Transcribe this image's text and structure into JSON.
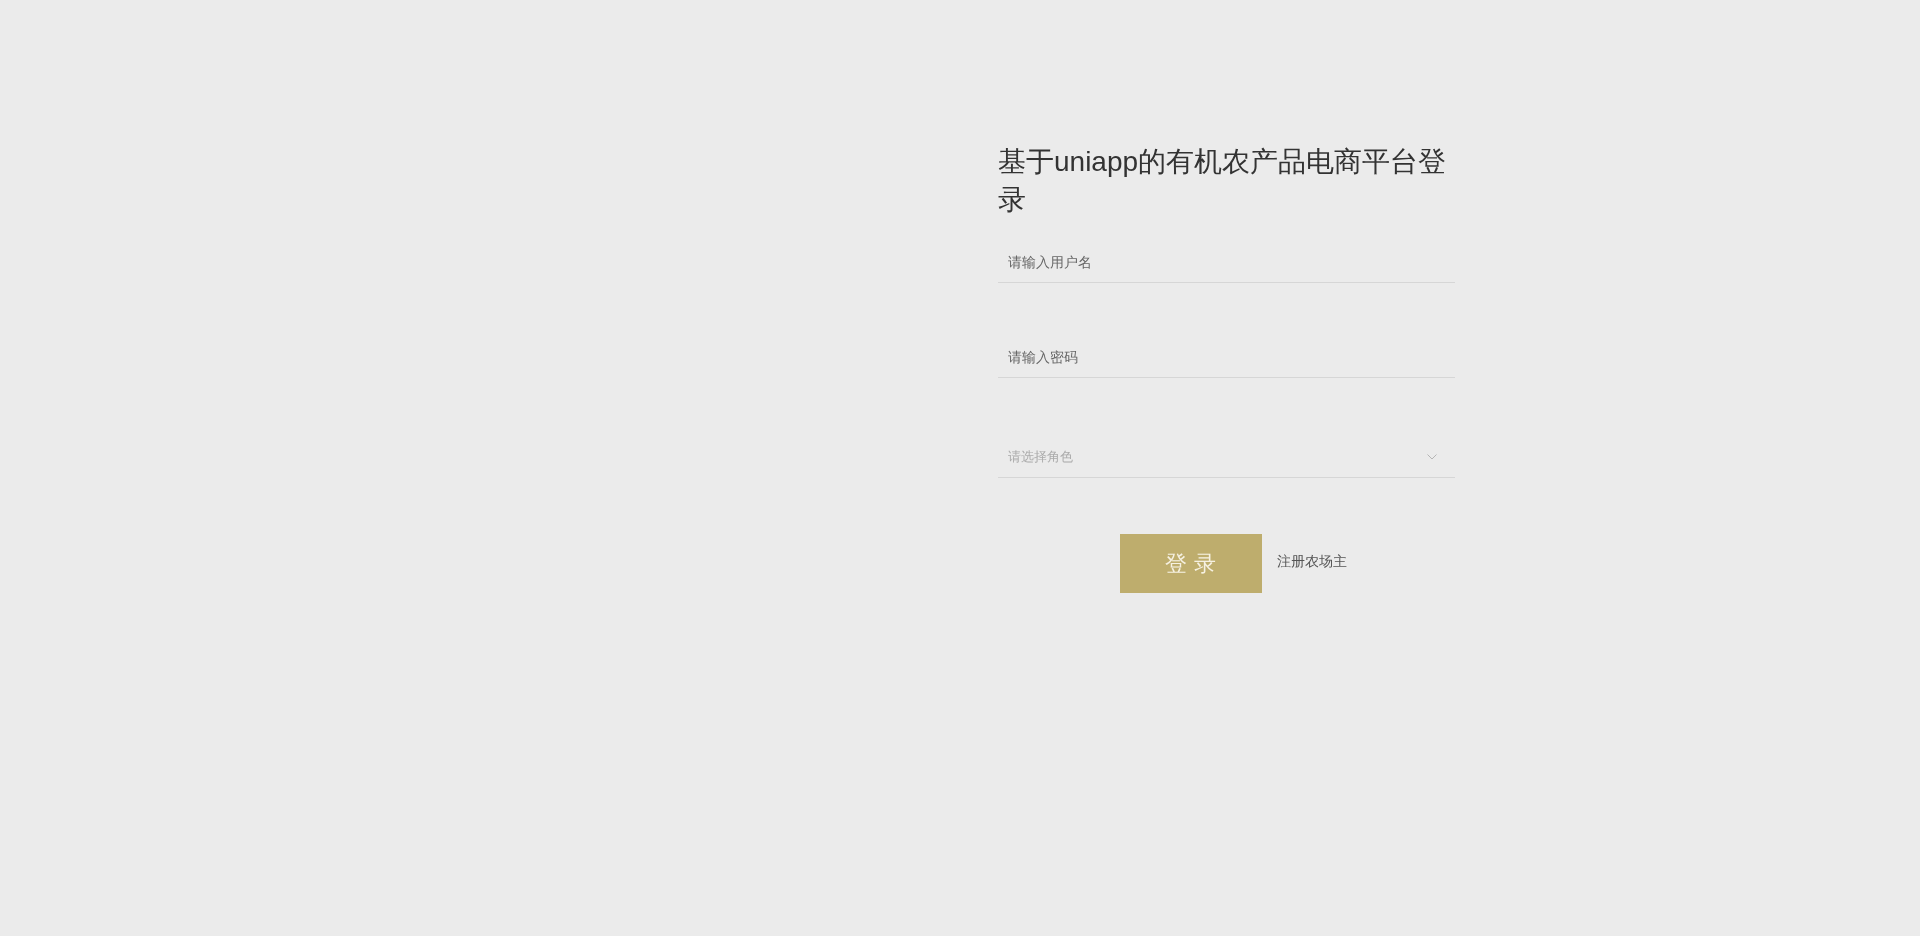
{
  "title": "基于uniapp的有机农产品电商平台登录",
  "fields": [
    {
      "kind": "text",
      "placeholder": "请输入用户名"
    },
    {
      "kind": "password",
      "placeholder": "请输入密码"
    },
    {
      "kind": "select",
      "placeholder": "请选择角色"
    }
  ],
  "login_button": "登 录",
  "register_link": "注册农场主"
}
